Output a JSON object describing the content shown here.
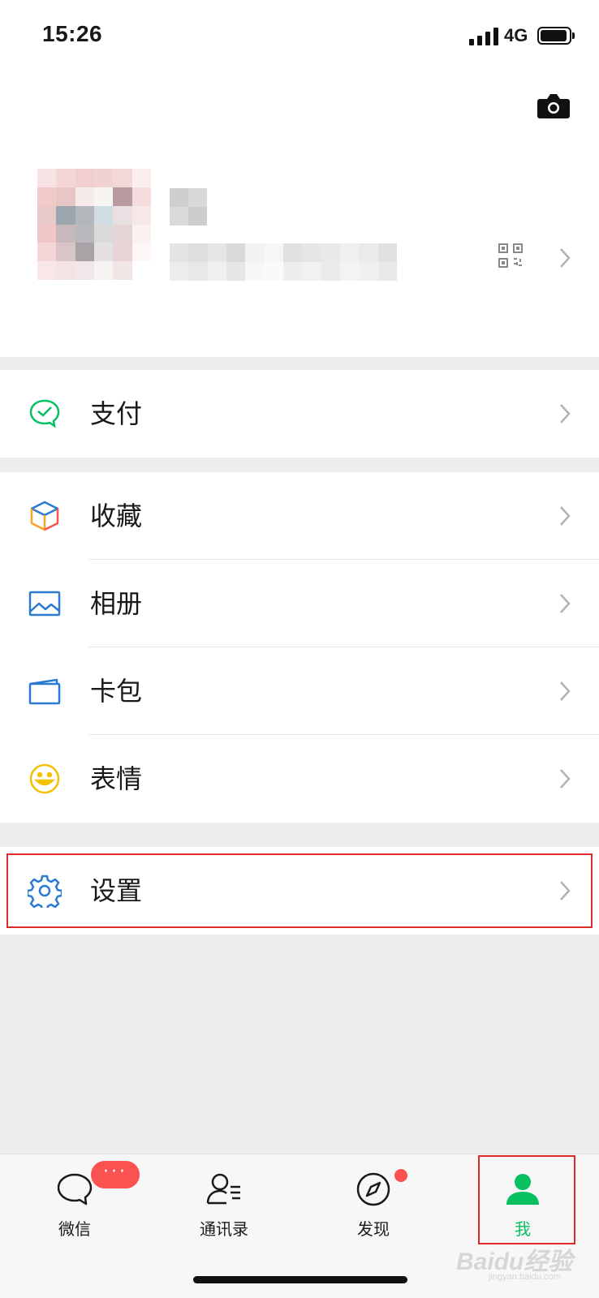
{
  "status_bar": {
    "time": "15:26",
    "network": "4G"
  },
  "profile": {
    "camera_icon": "camera-icon",
    "qr_icon": "qr-code-icon",
    "chevron_icon": "chevron-right-icon"
  },
  "menu": {
    "pay": {
      "label": "支付",
      "icon": "wechat-pay-icon",
      "color": "#07c160"
    },
    "favorites": {
      "label": "收藏",
      "icon": "favorites-cube-icon"
    },
    "album": {
      "label": "相册",
      "icon": "album-icon",
      "color": "#2b7bd3"
    },
    "cards": {
      "label": "卡包",
      "icon": "card-wallet-icon",
      "color": "#2b7bd3"
    },
    "stickers": {
      "label": "表情",
      "icon": "smiley-icon",
      "color": "#f2c200"
    },
    "settings": {
      "label": "设置",
      "icon": "gear-icon",
      "color": "#2b7bd3"
    }
  },
  "tab_bar": {
    "tabs": [
      {
        "label": "微信",
        "icon": "chat-bubble-icon",
        "badge": "···"
      },
      {
        "label": "通讯录",
        "icon": "contacts-icon"
      },
      {
        "label": "发现",
        "icon": "compass-icon"
      },
      {
        "label": "我",
        "icon": "person-icon",
        "active": true
      }
    ],
    "active_color": "#07c160",
    "badge_color": "#fa5151"
  },
  "watermark": {
    "main": "Baidu经验",
    "sub": "jingyan.baidu.com"
  }
}
